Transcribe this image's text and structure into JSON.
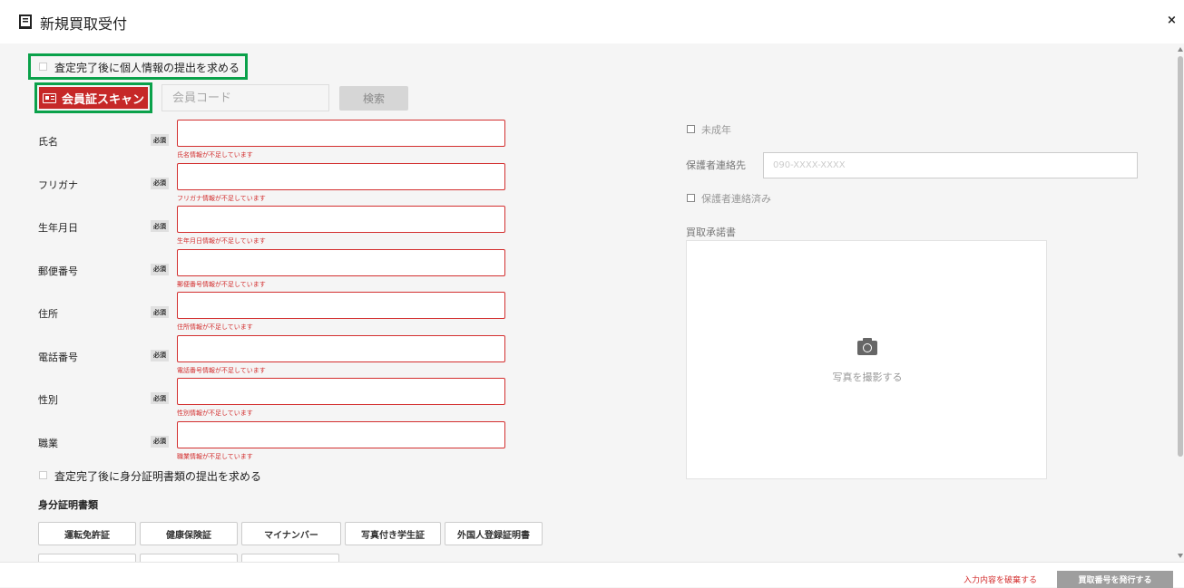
{
  "header": {
    "title": "新規買取受付",
    "close_label": "×"
  },
  "top": {
    "require_personal_info_label": "査定完了後に個人情報の提出を求める",
    "scan_button_label": "会員証スキャン",
    "member_code_placeholder": "会員コード",
    "search_button_label": "検索"
  },
  "form": {
    "required_badge": "必須",
    "fields": [
      {
        "label": "氏名",
        "error": "氏名情報が不足しています"
      },
      {
        "label": "フリガナ",
        "error": "フリガナ情報が不足しています"
      },
      {
        "label": "生年月日",
        "error": "生年月日情報が不足しています"
      },
      {
        "label": "郵便番号",
        "error": "郵便番号情報が不足しています"
      },
      {
        "label": "住所",
        "error": "住所情報が不足しています"
      },
      {
        "label": "電話番号",
        "error": "電話番号情報が不足しています"
      },
      {
        "label": "性別",
        "error": "性別情報が不足しています"
      },
      {
        "label": "職業",
        "error": "職業情報が不足しています"
      }
    ]
  },
  "id_docs": {
    "require_id_label": "査定完了後に身分証明書類の提出を求める",
    "section_title": "身分証明書類",
    "buttons": [
      "運転免許証",
      "健康保険証",
      "マイナンバー",
      "写真付き学生証",
      "外国人登録証明書"
    ]
  },
  "right": {
    "minor_label": "未成年",
    "guardian_contact_label": "保護者連絡先",
    "guardian_contact_placeholder": "090-XXXX-XXXX",
    "guardian_contacted_label": "保護者連絡済み",
    "consent_label": "買取承諾書",
    "photo_label": "写真を撮影する"
  },
  "footer": {
    "discard_label": "入力内容を破棄する",
    "issue_label": "買取番号を発行する"
  },
  "colors": {
    "accent_red": "#c62828",
    "error_red": "#d32f2f",
    "highlight_green": "#0aa14a"
  }
}
